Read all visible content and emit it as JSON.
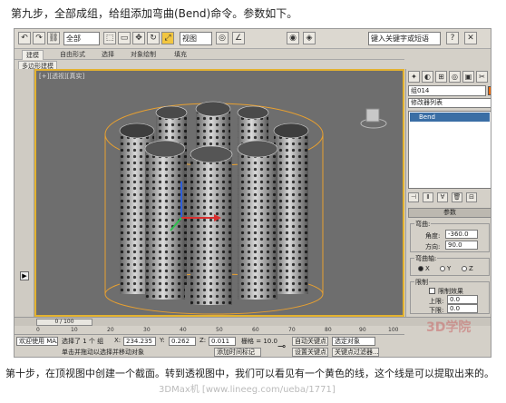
{
  "captions": {
    "top": "第九步，全部成组，给组添加弯曲(Bend)命令。参数如下。",
    "bottom": "第十步，在顶视图中创建一个截面。转到透视图中，我们可以看见有一个黄色的线，这个线是可以提取出来的。"
  },
  "toolbar": {
    "selection_dropdown": "全部",
    "view_dropdown": "视图",
    "search_field": "键入关键字或短语",
    "icons": [
      "undo-icon",
      "redo-icon",
      "select-link-icon",
      "unlink-icon",
      "bind-icon",
      "select-icon",
      "select-region-icon",
      "move-icon",
      "rotate-icon",
      "scale-icon",
      "snap-icon",
      "render-icon"
    ]
  },
  "tabs": {
    "items": [
      "建模",
      "自由形式",
      "选择",
      "对象绘制",
      "填充"
    ],
    "active_index": 0,
    "subtab": "多边形建模"
  },
  "viewport": {
    "label": "[+][透视][真实]"
  },
  "command_panel": {
    "object_name": "组014",
    "object_color": "#ff6a00",
    "modifier_list": "修改器列表",
    "stack_item": "Bend",
    "rollout_title": "参数",
    "bend_group_title": "弯曲:",
    "angle_label": "角度:",
    "angle_value": "-360.0",
    "direction_label": "方向:",
    "direction_value": "90.0",
    "axis_group_title": "弯曲轴:",
    "axis_options": [
      "X",
      "Y",
      "Z"
    ],
    "axis_selected": "X",
    "limit_group_title": "限制",
    "limit_effect_label": "限制效果",
    "upper_label": "上限:",
    "upper_value": "0.0",
    "lower_label": "下限:",
    "lower_value": "0.0"
  },
  "timeline": {
    "slider": "0 / 100",
    "ticks": [
      "0",
      "10",
      "20",
      "30",
      "40",
      "50",
      "60",
      "70",
      "80",
      "90",
      "100"
    ]
  },
  "status": {
    "welcome": "欢迎使用 MAXScr",
    "selection": "选择了 1 个 组",
    "prompt": "单击并拖动以选择并移动对象",
    "x_label": "X:",
    "x_value": "234.235",
    "y_label": "Y:",
    "y_value": "0.262",
    "z_label": "Z:",
    "z_value": "0.011",
    "grid": "栅格 = 10.0",
    "add_time_tag": "添加时间标记",
    "auto_key": "自动关键点",
    "set_key": "设置关键点",
    "key_filter": "关键点过滤器...",
    "selected_objects": "选定对象"
  },
  "watermarks": {
    "logo": "3D学院",
    "url": "3DMax机 [www.lineeg.com/ueba/1771]"
  }
}
